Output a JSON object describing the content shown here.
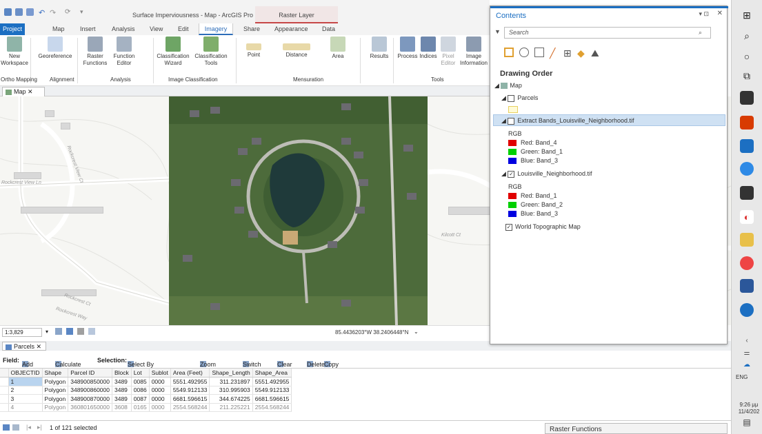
{
  "title_bar": {
    "document": "Surface Imperviousness - Map - ArcGIS Pro",
    "context_tab": "Raster Layer"
  },
  "tabs": [
    "Project",
    "Map",
    "Insert",
    "Analysis",
    "View",
    "Edit",
    "Imagery",
    "Share",
    "Appearance",
    "Data"
  ],
  "ribbon": {
    "buttons": {
      "new_workspace": "New Workspace",
      "georeference": "Georeference",
      "raster_functions": "Raster Functions",
      "function_editor": "Function Editor",
      "classification_wizard": "Classification Wizard",
      "classification_tools": "Classification Tools",
      "point": "Point",
      "distance": "Distance",
      "area": "Area",
      "results": "Results",
      "process": "Process",
      "indices": "Indices",
      "pixel_editor": "Pixel Editor",
      "image_information": "Image Information"
    },
    "groups": {
      "ortho_mapping": "Ortho Mapping",
      "alignment": "Alignment",
      "analysis": "Analysis",
      "image_classification": "Image Classification",
      "mensuration": "Mensuration",
      "tools": "Tools"
    }
  },
  "map": {
    "tab": "Map",
    "scale": "1:3,829",
    "coords": "85.4436203°W 38.2406448°N",
    "labels": [
      "Rockcrest View Ln",
      "Rockcrest View Ct",
      "Rockcrest Ct",
      "Rockcrest Way",
      "Kilcott Ct"
    ]
  },
  "contents": {
    "title": "Contents",
    "search_placeholder": "Search",
    "drawing_order": "Drawing Order",
    "map_node": "Map",
    "parcels": "Parcels",
    "extract_layer": "Extract Bands_Louisville_Neighborhood.tif",
    "rgb": "RGB",
    "extract_bands": [
      "Red: Band_4",
      "Green: Band_1",
      "Blue: Band_3"
    ],
    "neigh_layer": "Louisville_Neighborhood.tif",
    "neigh_bands": [
      "Red: Band_1",
      "Green: Band_2",
      "Blue: Band_3"
    ],
    "world_topo": "World Topographic Map",
    "colors": {
      "red": "#e00000",
      "green": "#00d000",
      "blue": "#0000e0"
    }
  },
  "table": {
    "tab": "Parcels",
    "toolbar": {
      "field": "Field:",
      "add": "Add",
      "calculate": "Calculate",
      "selection": "Selection:",
      "select_by_attributes": "Select By Attributes",
      "zoom_to": "Zoom To",
      "switch": "Switch",
      "clear": "Clear",
      "delete": "Delete",
      "copy": "Copy"
    },
    "columns": [
      "OBJECTID",
      "Shape",
      "Parcel ID",
      "Block",
      "Lot",
      "Sublot",
      "Area (Feet)",
      "Shape_Length",
      "Shape_Area"
    ],
    "rows": [
      [
        "1",
        "Polygon",
        "348900850000",
        "3489",
        "0085",
        "0000",
        "5551.492955",
        "311.231897",
        "5551.492955"
      ],
      [
        "2",
        "Polygon",
        "348900860000",
        "3489",
        "0086",
        "0000",
        "5549.912133",
        "310.995903",
        "5549.912133"
      ],
      [
        "3",
        "Polygon",
        "348900870000",
        "3489",
        "0087",
        "0000",
        "6681.596615",
        "344.674225",
        "6681.596615"
      ],
      [
        "4",
        "Polygon",
        "360801650000",
        "3608",
        "0165",
        "0000",
        "2554.568244",
        "211.225221",
        "2554.568244"
      ]
    ],
    "status": "1 of 121 selected"
  },
  "raster_functions": "Raster Functions",
  "taskbar": {
    "lang": "ENG",
    "time": "9:26 μμ",
    "date": "11/4/202"
  }
}
